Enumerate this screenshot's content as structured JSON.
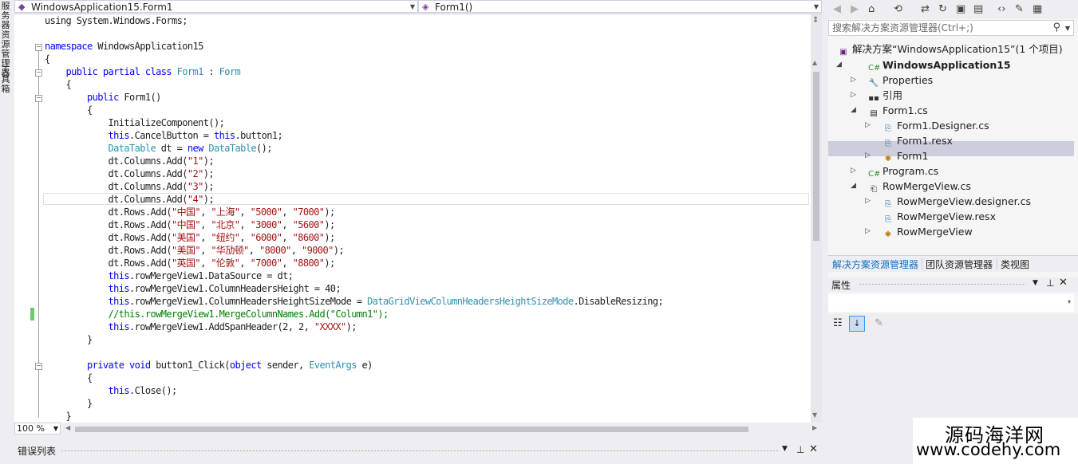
{
  "left_strip": {
    "tab1": "服务器资源管理器",
    "tab2": "工具箱"
  },
  "navbar": {
    "class_selector": "WindowsApplication15.Form1",
    "member_selector": "Form1()"
  },
  "editor": {
    "zoom": "100 %",
    "lines": [
      [
        {
          "t": "using System.Windows.Forms;",
          "c": ""
        }
      ],
      [],
      [
        {
          "t": "namespace",
          "c": "kw"
        },
        {
          "t": " WindowsApplication15",
          "c": ""
        }
      ],
      [
        {
          "t": "{",
          "c": ""
        }
      ],
      [
        {
          "t": "    ",
          "c": ""
        },
        {
          "t": "public partial class",
          "c": "kw"
        },
        {
          "t": " ",
          "c": ""
        },
        {
          "t": "Form1",
          "c": "ty"
        },
        {
          "t": " : ",
          "c": ""
        },
        {
          "t": "Form",
          "c": "ty"
        }
      ],
      [
        {
          "t": "    {",
          "c": ""
        }
      ],
      [
        {
          "t": "        ",
          "c": ""
        },
        {
          "t": "public",
          "c": "kw"
        },
        {
          "t": " Form1()",
          "c": ""
        }
      ],
      [
        {
          "t": "        {",
          "c": ""
        }
      ],
      [
        {
          "t": "            InitializeComponent();",
          "c": ""
        }
      ],
      [
        {
          "t": "            ",
          "c": ""
        },
        {
          "t": "this",
          "c": "kw"
        },
        {
          "t": ".CancelButton = ",
          "c": ""
        },
        {
          "t": "this",
          "c": "kw"
        },
        {
          "t": ".button1;",
          "c": ""
        }
      ],
      [
        {
          "t": "            ",
          "c": ""
        },
        {
          "t": "DataTable",
          "c": "ty"
        },
        {
          "t": " dt = ",
          "c": ""
        },
        {
          "t": "new",
          "c": "kw"
        },
        {
          "t": " ",
          "c": ""
        },
        {
          "t": "DataTable",
          "c": "ty"
        },
        {
          "t": "();",
          "c": ""
        }
      ],
      [
        {
          "t": "            dt.Columns.Add(",
          "c": ""
        },
        {
          "t": "\"1\"",
          "c": "st"
        },
        {
          "t": ");",
          "c": ""
        }
      ],
      [
        {
          "t": "            dt.Columns.Add(",
          "c": ""
        },
        {
          "t": "\"2\"",
          "c": "st"
        },
        {
          "t": ");",
          "c": ""
        }
      ],
      [
        {
          "t": "            dt.Columns.Add(",
          "c": ""
        },
        {
          "t": "\"3\"",
          "c": "st"
        },
        {
          "t": ");",
          "c": ""
        }
      ],
      [
        {
          "t": "            dt.Columns.Add(",
          "c": ""
        },
        {
          "t": "\"4\"",
          "c": "st"
        },
        {
          "t": ");",
          "c": ""
        }
      ],
      [
        {
          "t": "            dt.Rows.Add(",
          "c": ""
        },
        {
          "t": "\"中国\"",
          "c": "st"
        },
        {
          "t": ", ",
          "c": ""
        },
        {
          "t": "\"上海\"",
          "c": "st"
        },
        {
          "t": ", ",
          "c": ""
        },
        {
          "t": "\"5000\"",
          "c": "st"
        },
        {
          "t": ", ",
          "c": ""
        },
        {
          "t": "\"7000\"",
          "c": "st"
        },
        {
          "t": ");",
          "c": ""
        }
      ],
      [
        {
          "t": "            dt.Rows.Add(",
          "c": ""
        },
        {
          "t": "\"中国\"",
          "c": "st"
        },
        {
          "t": ", ",
          "c": ""
        },
        {
          "t": "\"北京\"",
          "c": "st"
        },
        {
          "t": ", ",
          "c": ""
        },
        {
          "t": "\"3000\"",
          "c": "st"
        },
        {
          "t": ", ",
          "c": ""
        },
        {
          "t": "\"5600\"",
          "c": "st"
        },
        {
          "t": ");",
          "c": ""
        }
      ],
      [
        {
          "t": "            dt.Rows.Add(",
          "c": ""
        },
        {
          "t": "\"美国\"",
          "c": "st"
        },
        {
          "t": ", ",
          "c": ""
        },
        {
          "t": "\"纽约\"",
          "c": "st"
        },
        {
          "t": ", ",
          "c": ""
        },
        {
          "t": "\"6000\"",
          "c": "st"
        },
        {
          "t": ", ",
          "c": ""
        },
        {
          "t": "\"8600\"",
          "c": "st"
        },
        {
          "t": ");",
          "c": ""
        }
      ],
      [
        {
          "t": "            dt.Rows.Add(",
          "c": ""
        },
        {
          "t": "\"美国\"",
          "c": "st"
        },
        {
          "t": ", ",
          "c": ""
        },
        {
          "t": "\"华劢顿\"",
          "c": "st"
        },
        {
          "t": ", ",
          "c": ""
        },
        {
          "t": "\"8000\"",
          "c": "st"
        },
        {
          "t": ", ",
          "c": ""
        },
        {
          "t": "\"9000\"",
          "c": "st"
        },
        {
          "t": ");",
          "c": ""
        }
      ],
      [
        {
          "t": "            dt.Rows.Add(",
          "c": ""
        },
        {
          "t": "\"英国\"",
          "c": "st"
        },
        {
          "t": ", ",
          "c": ""
        },
        {
          "t": "\"伦敦\"",
          "c": "st"
        },
        {
          "t": ", ",
          "c": ""
        },
        {
          "t": "\"7000\"",
          "c": "st"
        },
        {
          "t": ", ",
          "c": ""
        },
        {
          "t": "\"8800\"",
          "c": "st"
        },
        {
          "t": ");",
          "c": ""
        }
      ],
      [
        {
          "t": "            ",
          "c": ""
        },
        {
          "t": "this",
          "c": "kw"
        },
        {
          "t": ".rowMergeView1.DataSource = dt;",
          "c": ""
        }
      ],
      [
        {
          "t": "            ",
          "c": ""
        },
        {
          "t": "this",
          "c": "kw"
        },
        {
          "t": ".rowMergeView1.ColumnHeadersHeight = 40;",
          "c": ""
        }
      ],
      [
        {
          "t": "            ",
          "c": ""
        },
        {
          "t": "this",
          "c": "kw"
        },
        {
          "t": ".rowMergeView1.ColumnHeadersHeightSizeMode = ",
          "c": ""
        },
        {
          "t": "DataGridViewColumnHeadersHeightSizeMode",
          "c": "ty"
        },
        {
          "t": ".DisableResizing;",
          "c": ""
        }
      ],
      [
        {
          "t": "            //this.rowMergeView1.MergeColumnNames.Add(\"Column1\");",
          "c": "cm"
        }
      ],
      [
        {
          "t": "            ",
          "c": ""
        },
        {
          "t": "this",
          "c": "kw"
        },
        {
          "t": ".rowMergeView1.AddSpanHeader(2, 2, ",
          "c": ""
        },
        {
          "t": "\"XXXX\"",
          "c": "st"
        },
        {
          "t": ");",
          "c": ""
        }
      ],
      [
        {
          "t": "        }",
          "c": ""
        }
      ],
      [],
      [
        {
          "t": "        ",
          "c": ""
        },
        {
          "t": "private void",
          "c": "kw"
        },
        {
          "t": " button1_Click(",
          "c": ""
        },
        {
          "t": "object",
          "c": "kw"
        },
        {
          "t": " sender, ",
          "c": ""
        },
        {
          "t": "EventArgs",
          "c": "ty"
        },
        {
          "t": " e)",
          "c": ""
        }
      ],
      [
        {
          "t": "        {",
          "c": ""
        }
      ],
      [
        {
          "t": "            ",
          "c": ""
        },
        {
          "t": "this",
          "c": "kw"
        },
        {
          "t": ".Close();",
          "c": ""
        }
      ],
      [
        {
          "t": "        }",
          "c": ""
        }
      ],
      [
        {
          "t": "    }",
          "c": ""
        }
      ]
    ]
  },
  "error_list": {
    "title": "错误列表"
  },
  "solution_explorer": {
    "search_placeholder": "搜索解决方案资源管理器(Ctrl+;)",
    "nodes": [
      {
        "label": "解决方案“WindowsApplication15”(1 个项目)",
        "level": 0,
        "icon": "solution-icon",
        "expander": "",
        "bold": false
      },
      {
        "label": "WindowsApplication15",
        "level": 1,
        "icon": "csharp-project-icon",
        "expander": "open",
        "bold": true
      },
      {
        "label": "Properties",
        "level": 2,
        "icon": "wrench-icon",
        "expander": "closed",
        "bold": false
      },
      {
        "label": "引用",
        "level": 2,
        "icon": "references-icon",
        "expander": "closed",
        "bold": false
      },
      {
        "label": "Form1.cs",
        "level": 2,
        "icon": "form-icon",
        "expander": "open",
        "bold": false
      },
      {
        "label": "Form1.Designer.cs",
        "level": 3,
        "icon": "cs-file-icon",
        "expander": "closed",
        "bold": false
      },
      {
        "label": "Form1.resx",
        "level": 3,
        "icon": "resx-file-icon",
        "expander": "",
        "bold": false
      },
      {
        "label": "Form1",
        "level": 3,
        "icon": "class-icon",
        "expander": "closed",
        "bold": false
      },
      {
        "label": "Program.cs",
        "level": 2,
        "icon": "csharp-file-icon",
        "expander": "closed",
        "bold": false
      },
      {
        "label": "RowMergeView.cs",
        "level": 2,
        "icon": "component-icon",
        "expander": "open",
        "bold": false
      },
      {
        "label": "RowMergeView.designer.cs",
        "level": 3,
        "icon": "cs-file-icon",
        "expander": "closed",
        "bold": false
      },
      {
        "label": "RowMergeView.resx",
        "level": 3,
        "icon": "resx-file-icon",
        "expander": "",
        "bold": false
      },
      {
        "label": "RowMergeView",
        "level": 3,
        "icon": "class-icon",
        "expander": "closed",
        "bold": false
      }
    ],
    "tabs": [
      "解决方案资源管理器",
      "团队资源管理器",
      "类视图"
    ]
  },
  "properties": {
    "title": "属性"
  },
  "watermark": {
    "line1": "源码海洋网",
    "line2": "www.codehy.com"
  },
  "colors": {
    "keyword": "#0000ff",
    "type": "#2b91af",
    "string": "#a31515",
    "comment": "#008000",
    "selected_tab": "#0e70c0"
  }
}
